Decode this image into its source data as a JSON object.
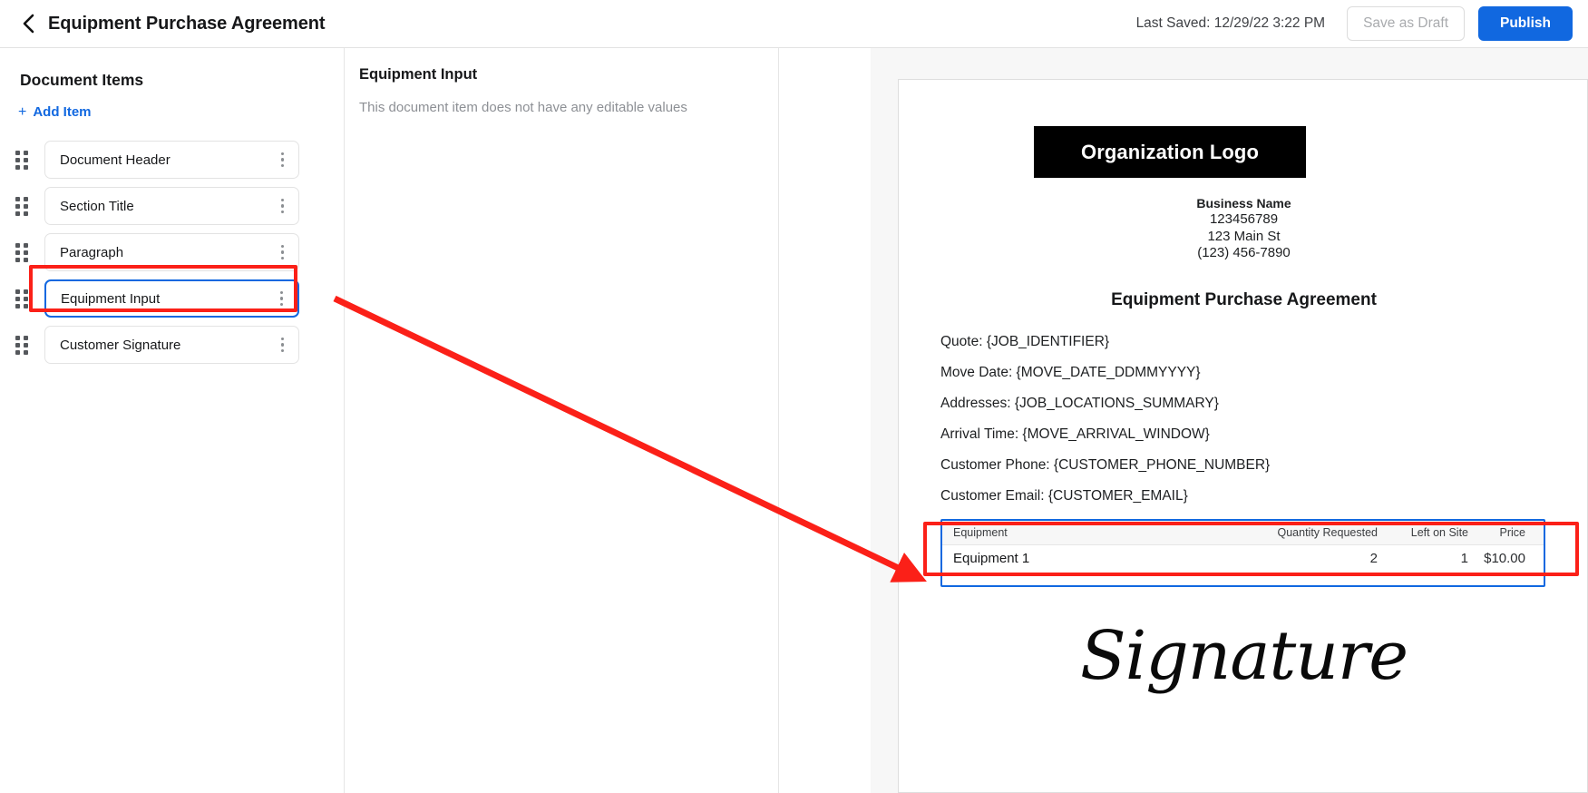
{
  "topbar": {
    "back_icon": "chevron-left-icon",
    "title": "Equipment Purchase Agreement",
    "last_saved": "Last Saved: 12/29/22 3:22 PM",
    "save_draft_label": "Save as Draft",
    "publish_label": "Publish",
    "publish_color": "#1168e0"
  },
  "sidebar": {
    "title": "Document Items",
    "add_item_label": "Add Item",
    "add_item_plus": "+",
    "items": [
      {
        "label": "Document Header",
        "selected": false
      },
      {
        "label": "Section Title",
        "selected": false
      },
      {
        "label": "Paragraph",
        "selected": false
      },
      {
        "label": "Equipment Input",
        "selected": true
      },
      {
        "label": "Customer Signature",
        "selected": false
      }
    ]
  },
  "middle": {
    "title": "Equipment Input",
    "subtitle": "This document item does not have any editable values"
  },
  "preview": {
    "logo_text": "Organization Logo",
    "business": {
      "name": "Business Name",
      "number": "123456789",
      "address": "123 Main St",
      "phone": "(123) 456-7890"
    },
    "doc_title": "Equipment Purchase Agreement",
    "fields": [
      "Quote: {JOB_IDENTIFIER}",
      "Move Date: {MOVE_DATE_DDMMYYYY}",
      "Addresses: {JOB_LOCATIONS_SUMMARY}",
      "Arrival Time: {MOVE_ARRIVAL_WINDOW}",
      "Customer Phone: {CUSTOMER_PHONE_NUMBER}",
      "Customer Email: {CUSTOMER_EMAIL}"
    ],
    "equipment_table": {
      "columns": [
        "Equipment",
        "Quantity Requested",
        "Left on Site",
        "Price"
      ],
      "rows": [
        {
          "equipment": "Equipment 1",
          "quantity_requested": "2",
          "left_on_site": "1",
          "price": "$10.00"
        }
      ],
      "selection_color": "#1168e0"
    },
    "signature_text": "Signature"
  },
  "annotations": {
    "highlight_color": "#fb2018",
    "arrow_from": "Equipment Input sidebar item",
    "arrow_to": "Equipment table in document preview"
  }
}
